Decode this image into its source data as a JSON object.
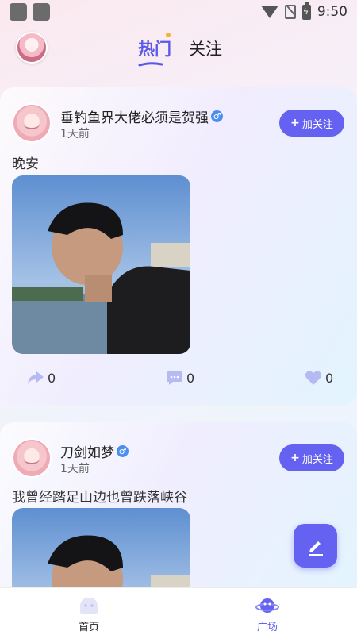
{
  "status_bar": {
    "time": "9:50"
  },
  "header": {
    "tabs": [
      {
        "label": "热门",
        "active": true
      },
      {
        "label": "关注",
        "active": false
      }
    ]
  },
  "posts": [
    {
      "username": "垂钓鱼界大佬必须是贺强",
      "gender": "♂",
      "time": "1天前",
      "follow_label": "加关注",
      "content": "晚安",
      "shares": "0",
      "comments": "0",
      "likes": "0"
    },
    {
      "username": "刀剑如梦",
      "gender": "♂",
      "time": "1天前",
      "follow_label": "加关注",
      "content": "我曾经踏足山边也曾跌落峡谷"
    }
  ],
  "bottom_nav": [
    {
      "label": "首页",
      "icon": "home-icon",
      "active": false
    },
    {
      "label": "广场",
      "icon": "planet-icon",
      "active": true
    }
  ],
  "colors": {
    "accent": "#6662f1",
    "gender_male": "#4a8ff0"
  }
}
